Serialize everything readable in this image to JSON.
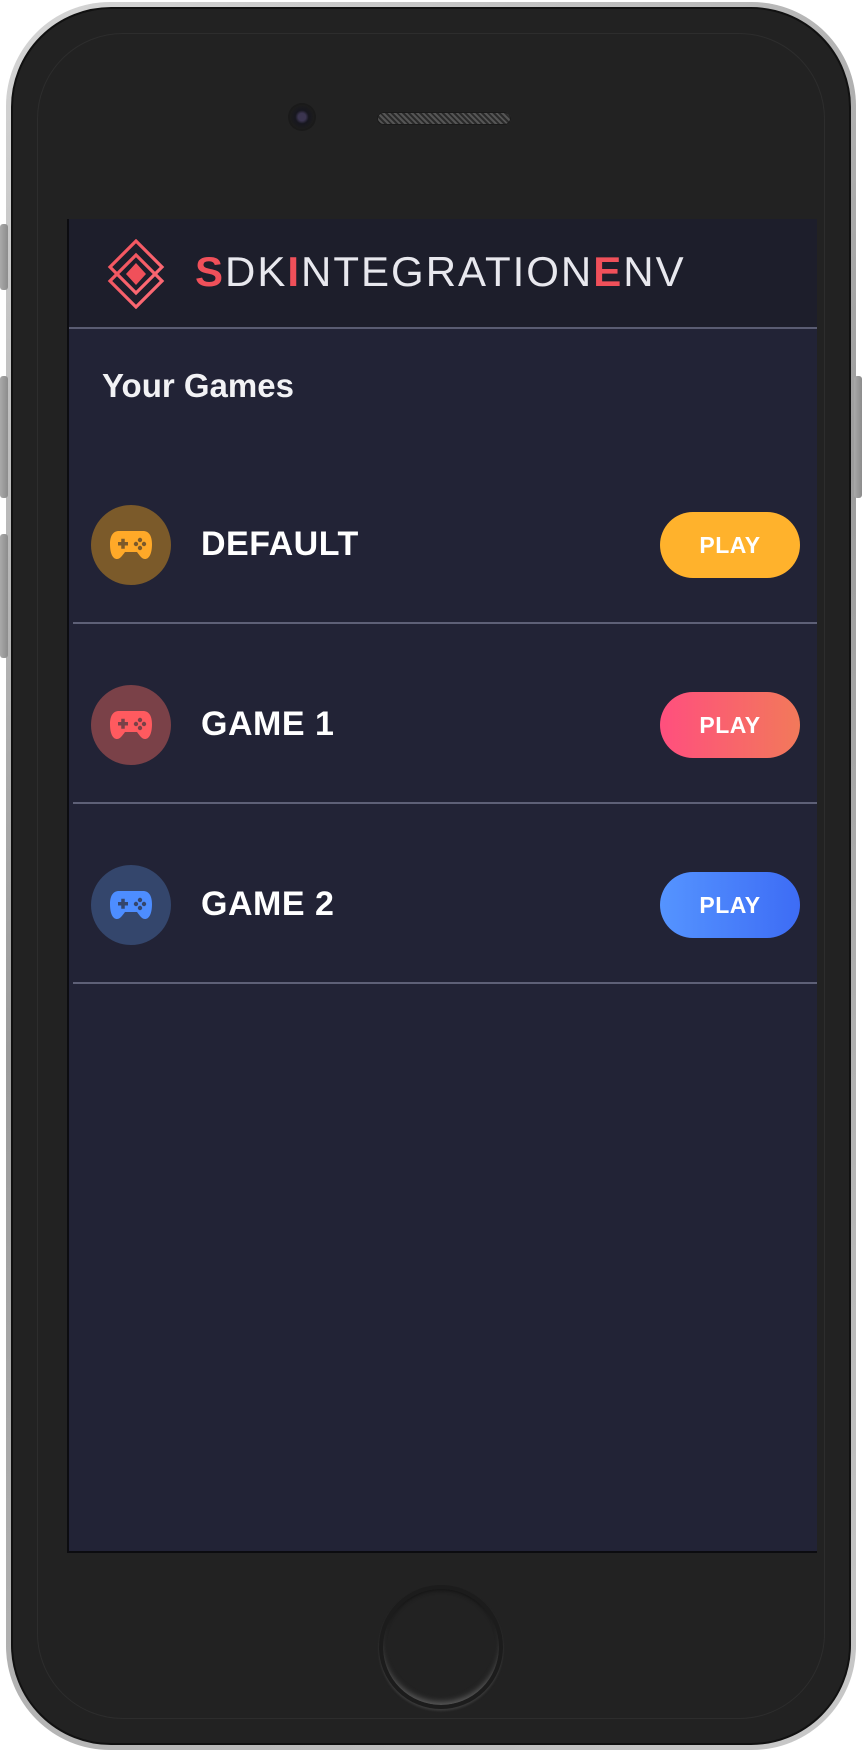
{
  "header": {
    "brand_parts": [
      {
        "text": "S",
        "accent": true
      },
      {
        "text": "DK",
        "accent": false
      },
      {
        "text": "I",
        "accent": true
      },
      {
        "text": "NTEGRATION",
        "accent": false
      },
      {
        "text": "E",
        "accent": true
      },
      {
        "text": "NV",
        "accent": false
      }
    ],
    "logo_icon": "diamond-logo-icon",
    "accent_color": "#f0505a"
  },
  "section": {
    "title": "Your Games"
  },
  "games": [
    {
      "name": "DEFAULT",
      "icon": "gamepad-icon",
      "icon_color": "#ffa928",
      "avatar_bg": "#7b5a2a",
      "play_label": "PLAY",
      "button_colors": [
        "#ffb22c",
        "#ffb22c"
      ]
    },
    {
      "name": "GAME 1",
      "icon": "gamepad-icon",
      "icon_color": "#ff5a5f",
      "avatar_bg": "#7a4148",
      "play_label": "PLAY",
      "button_colors": [
        "#ff4f7e",
        "#f2795a"
      ]
    },
    {
      "name": "GAME 2",
      "icon": "gamepad-icon",
      "icon_color": "#4d8dff",
      "avatar_bg": "#34466c",
      "play_label": "PLAY",
      "button_colors": [
        "#5594ff",
        "#3d6cf5"
      ]
    }
  ]
}
